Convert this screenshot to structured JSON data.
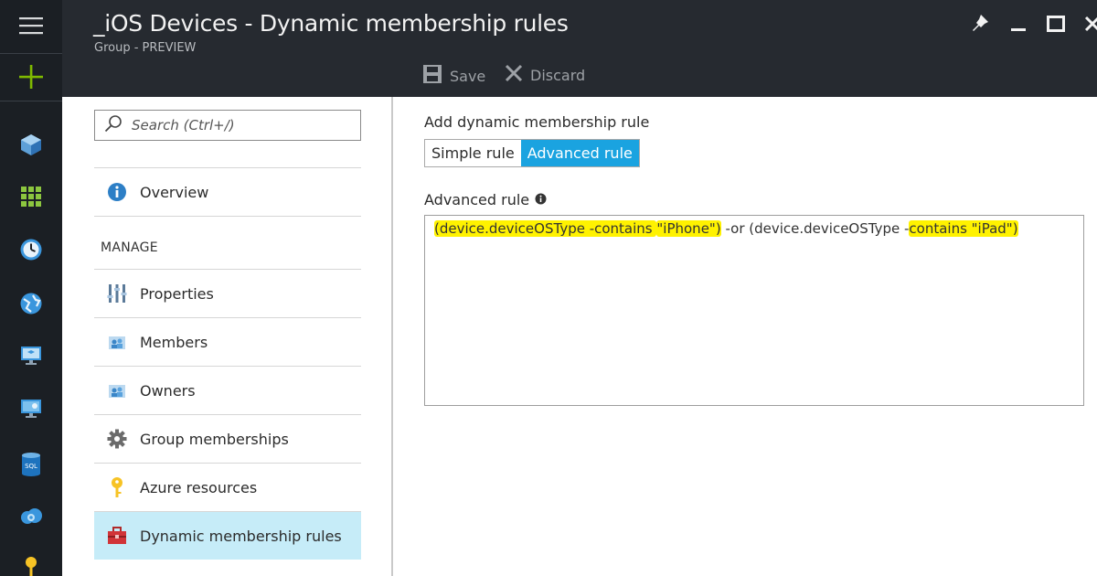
{
  "header": {
    "title": "_iOS Devices - Dynamic membership rules",
    "subtitle": "Group - PREVIEW",
    "commands": {
      "save_label": "Save",
      "discard_label": "Discard"
    }
  },
  "rail": {
    "icons": [
      "hamburger-icon",
      "plus-icon",
      "cube-icon",
      "grid-icon",
      "clock-icon",
      "globe-icon",
      "monitor-icon",
      "vm-icon",
      "sql-icon",
      "cloud-gear-icon",
      "key-icon"
    ]
  },
  "nav": {
    "search_placeholder": "Search (Ctrl+/)",
    "overview_label": "Overview",
    "manage_header": "MANAGE",
    "items": [
      {
        "label": "Properties",
        "icon": "sliders-icon"
      },
      {
        "label": "Members",
        "icon": "users-icon"
      },
      {
        "label": "Owners",
        "icon": "owners-icon"
      },
      {
        "label": "Group memberships",
        "icon": "gear-icon"
      },
      {
        "label": "Azure resources",
        "icon": "key-icon"
      },
      {
        "label": "Dynamic membership rules",
        "icon": "toolbox-icon",
        "active": true
      }
    ]
  },
  "content": {
    "add_rule_label": "Add dynamic membership rule",
    "toggle": {
      "simple_label": "Simple rule",
      "advanced_label": "Advanced rule",
      "selected": "Advanced rule"
    },
    "advanced_rule_label": "Advanced rule",
    "rule_parts": [
      "(device.deviceOSType -contains ",
      "\"iPhone\")",
      " -or (device.deviceOSType -",
      "contains \"iPad\")"
    ]
  },
  "colors": {
    "rail_bg": "#1b1f24",
    "header_bg": "#262a30",
    "accent": "#1aa3e0",
    "active_nav_bg": "#c6ecf8",
    "highlight": "#fff200"
  }
}
